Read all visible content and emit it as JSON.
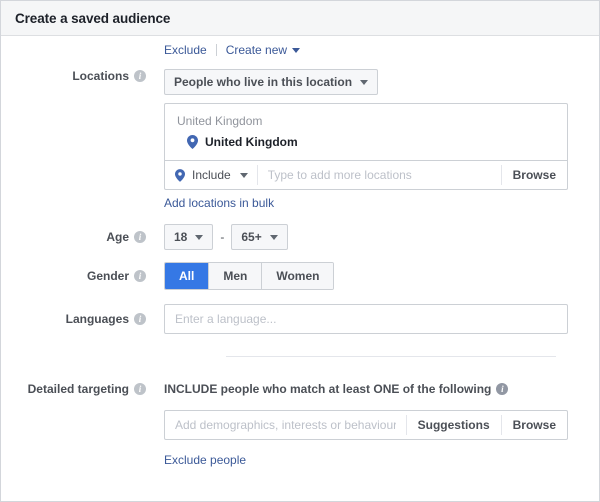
{
  "header": {
    "title": "Create a saved audience"
  },
  "toplinks": {
    "exclude": "Exclude",
    "create_new": "Create new",
    "caret_icon": "chevron-down-icon"
  },
  "locations": {
    "label": "Locations",
    "info_icon": "info-icon",
    "scope_select": "People who live in this location",
    "group_title": "United Kingdom",
    "selected_item": "United Kingdom",
    "pin_icon": "map-pin-icon",
    "include_label": "Include",
    "input_placeholder": "Type to add more locations",
    "input_value": "",
    "browse_label": "Browse",
    "bulk_link": "Add locations in bulk"
  },
  "age": {
    "label": "Age",
    "info_icon": "info-icon",
    "min": "18",
    "max": "65+",
    "separator": "-"
  },
  "gender": {
    "label": "Gender",
    "info_icon": "info-icon",
    "options": [
      {
        "label": "All",
        "selected": true
      },
      {
        "label": "Men",
        "selected": false
      },
      {
        "label": "Women",
        "selected": false
      }
    ]
  },
  "languages": {
    "label": "Languages",
    "info_icon": "info-icon",
    "placeholder": "Enter a language...",
    "value": ""
  },
  "detailed_targeting": {
    "label": "Detailed targeting",
    "info_icon": "info-icon",
    "heading": "INCLUDE people who match at least ONE of the following",
    "heading_info_icon": "info-icon",
    "input_placeholder": "Add demographics, interests or behaviours",
    "input_value": "",
    "suggestions_label": "Suggestions",
    "browse_label": "Browse",
    "exclude_link": "Exclude people"
  },
  "colors": {
    "accent_blue": "#3578e5",
    "link_blue": "#3b5998",
    "header_bg": "#f5f6f7",
    "border": "#ccd0d5",
    "label_text": "#4b4f56"
  }
}
